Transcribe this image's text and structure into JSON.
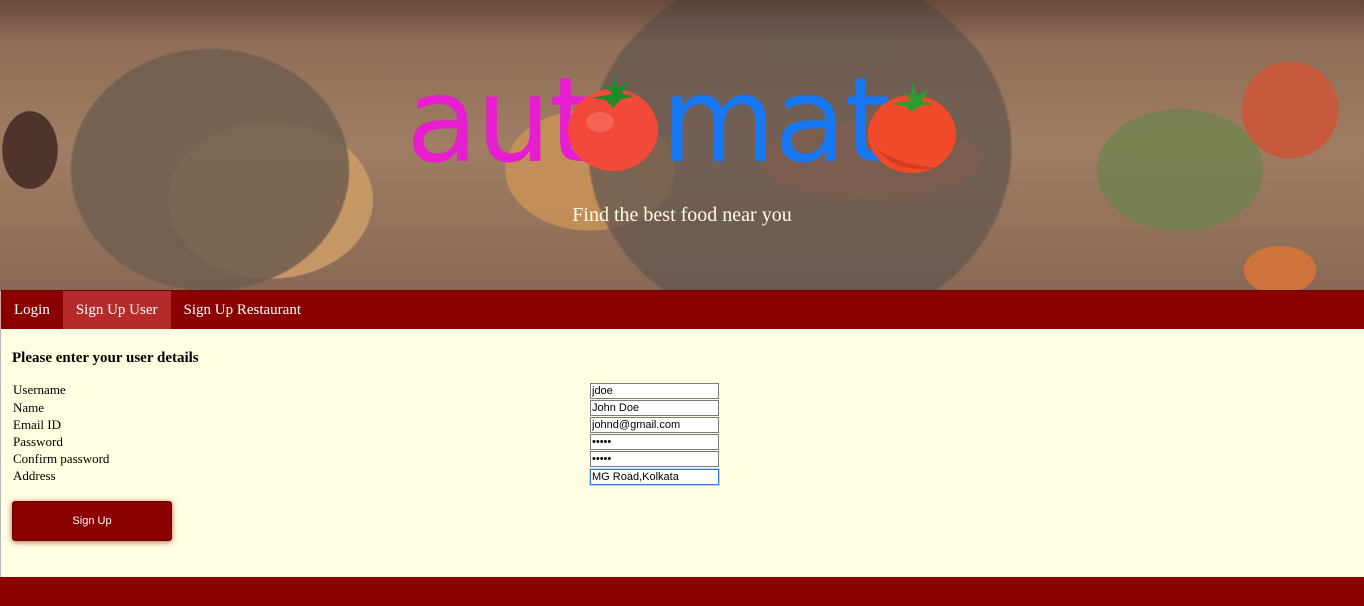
{
  "hero": {
    "logo_part1": "aut",
    "logo_part2": "mat",
    "tagline": "Find the best food near you"
  },
  "nav": {
    "items": [
      {
        "label": "Login",
        "active": false
      },
      {
        "label": "Sign Up User",
        "active": true
      },
      {
        "label": "Sign Up Restaurant",
        "active": false
      }
    ]
  },
  "form": {
    "heading": "Please enter your user details",
    "fields": [
      {
        "label": "Username",
        "value": "jdoe"
      },
      {
        "label": "Name",
        "value": "John Doe"
      },
      {
        "label": "Email ID",
        "value": "johnd@gmail.com"
      },
      {
        "label": "Password",
        "value": "•••••"
      },
      {
        "label": "Confirm password",
        "value": "•••••"
      },
      {
        "label": "Address",
        "value": "MG Road,Kolkata"
      }
    ],
    "submit_label": "Sign Up"
  },
  "colors": {
    "brand_red": "#8b0000",
    "active_tab": "#b52a2a",
    "page_background": "#fffee0",
    "logo_pink": "#e61ecf",
    "logo_blue": "#1877f2",
    "tomato_red": "#f04a3a"
  }
}
